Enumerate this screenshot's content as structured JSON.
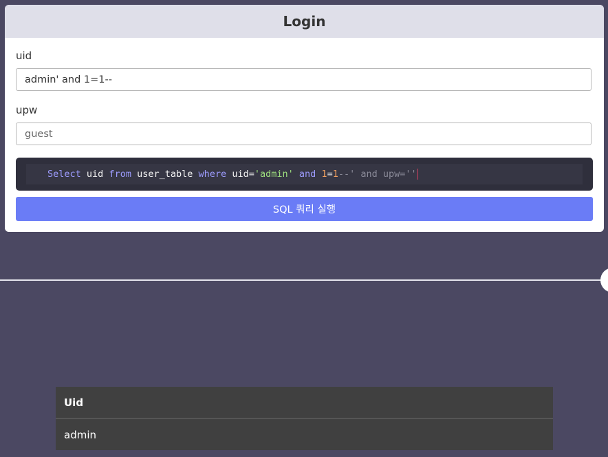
{
  "login": {
    "title": "Login",
    "uid_label": "uid",
    "uid_value": "admin' and 1=1--",
    "upw_label": "upw",
    "upw_placeholder": "guest",
    "query_tokens": [
      {
        "text": "Select",
        "cls": "kw"
      },
      {
        "text": " ",
        "cls": "id"
      },
      {
        "text": "uid",
        "cls": "id"
      },
      {
        "text": " ",
        "cls": "id"
      },
      {
        "text": "from",
        "cls": "kw"
      },
      {
        "text": " ",
        "cls": "id"
      },
      {
        "text": "user_table",
        "cls": "id"
      },
      {
        "text": " ",
        "cls": "id"
      },
      {
        "text": "where",
        "cls": "kw"
      },
      {
        "text": " ",
        "cls": "id"
      },
      {
        "text": "uid",
        "cls": "id"
      },
      {
        "text": "=",
        "cls": "id"
      },
      {
        "text": "'admin'",
        "cls": "str"
      },
      {
        "text": " ",
        "cls": "id"
      },
      {
        "text": "and",
        "cls": "kw"
      },
      {
        "text": " ",
        "cls": "id"
      },
      {
        "text": "1",
        "cls": "num"
      },
      {
        "text": "=",
        "cls": "id"
      },
      {
        "text": "1",
        "cls": "num"
      },
      {
        "text": "--' and upw=''",
        "cls": "cm"
      }
    ],
    "run_button_label": "SQL 쿼리 실행"
  },
  "results": {
    "header": "Uid",
    "rows": [
      "admin"
    ]
  }
}
